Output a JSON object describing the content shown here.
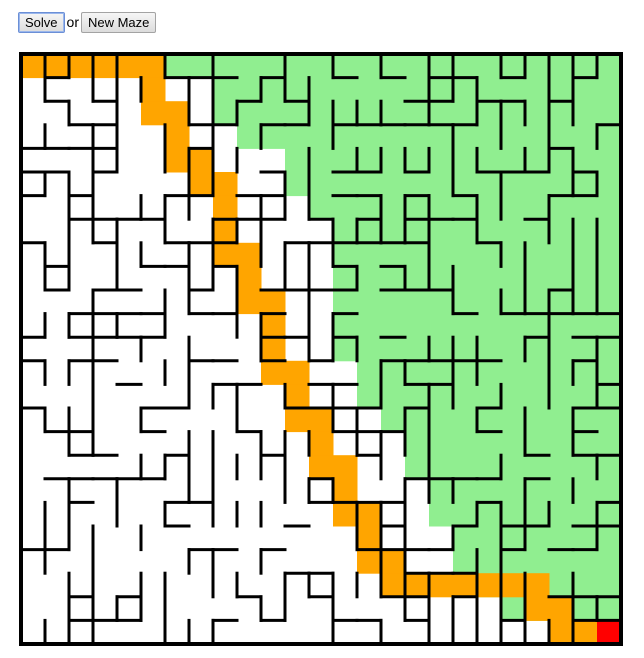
{
  "toolbar": {
    "solve_label": "Solve",
    "or_label": "or",
    "new_maze_label": "New Maze"
  },
  "maze": {
    "rows": 25,
    "cols": 25,
    "colors": {
      "wall": "#000000",
      "visited": "#90ee90",
      "path": "#ffa500",
      "end": "#ff0000",
      "background": "#ffffff"
    },
    "solution_path": [
      [
        0,
        0
      ],
      [
        0,
        1
      ],
      [
        0,
        2
      ],
      [
        0,
        3
      ],
      [
        0,
        4
      ],
      [
        0,
        5
      ],
      [
        1,
        5
      ],
      [
        2,
        5
      ],
      [
        2,
        6
      ],
      [
        2,
        7
      ],
      [
        3,
        7
      ],
      [
        4,
        7
      ],
      [
        4,
        8
      ],
      [
        4,
        9
      ],
      [
        4,
        10
      ],
      [
        5,
        10
      ],
      [
        6,
        10
      ],
      [
        7,
        10
      ],
      [
        7,
        11
      ],
      [
        8,
        11
      ],
      [
        8,
        12
      ],
      [
        9,
        12
      ],
      [
        10,
        12
      ],
      [
        11,
        12
      ],
      [
        12,
        12
      ],
      [
        12,
        13
      ],
      [
        13,
        13
      ],
      [
        14,
        13
      ],
      [
        15,
        13
      ],
      [
        15,
        14
      ],
      [
        16,
        14
      ],
      [
        17,
        14
      ],
      [
        17,
        15
      ],
      [
        18,
        15
      ],
      [
        19,
        15
      ],
      [
        19,
        16
      ],
      [
        20,
        16
      ],
      [
        21,
        16
      ],
      [
        22,
        16
      ],
      [
        22,
        17
      ],
      [
        23,
        17
      ],
      [
        23,
        18
      ],
      [
        23,
        19
      ],
      [
        23,
        20
      ],
      [
        23,
        21
      ],
      [
        23,
        22
      ],
      [
        24,
        22
      ],
      [
        24,
        23
      ],
      [
        25,
        23
      ],
      [
        25,
        24
      ]
    ],
    "end_cell": [
      25,
      24
    ]
  }
}
